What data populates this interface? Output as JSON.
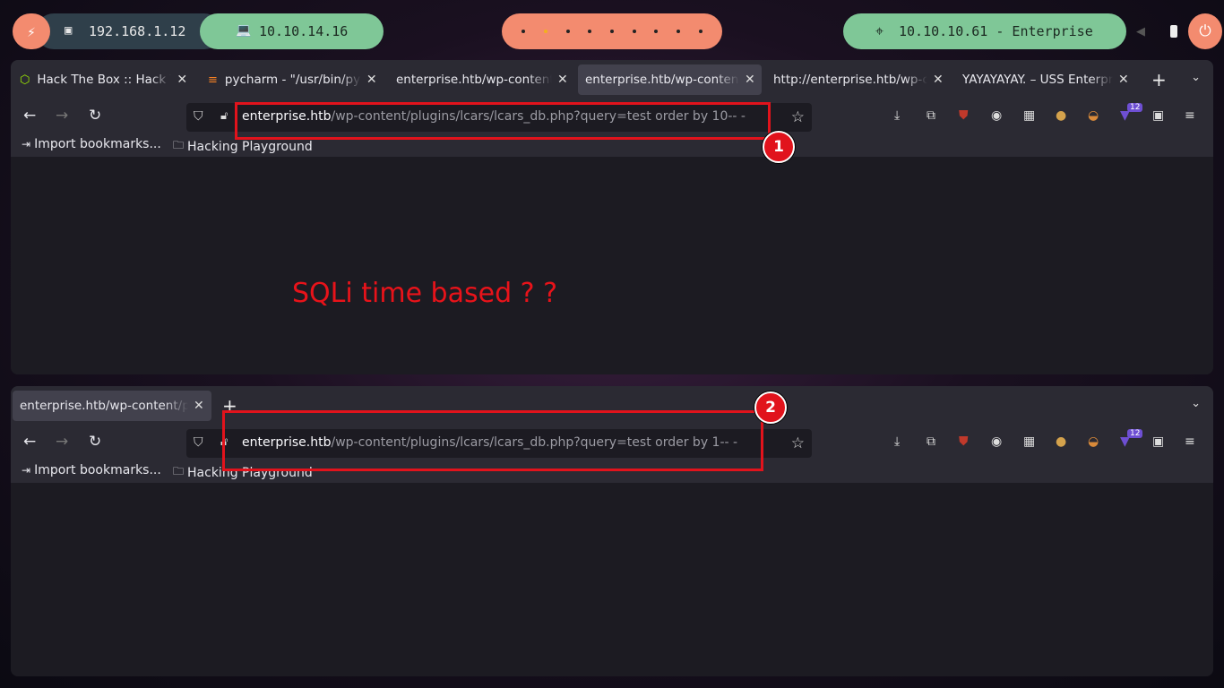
{
  "topbar": {
    "ip_local": "192.168.1.12",
    "ip_vpn": "10.10.14.16",
    "target": "10.10.10.61 - Enterprise",
    "workspaces": 9,
    "active_workspace": 2
  },
  "window1": {
    "tabs": [
      {
        "label": "Hack The Box :: Hack The Box",
        "icon": "htb-icon"
      },
      {
        "label": "pycharm - \"/usr/bin/pycharm\"",
        "icon": "stackoverflow-icon"
      },
      {
        "label": "enterprise.htb/wp-content/plugins",
        "icon": ""
      },
      {
        "label": "enterprise.htb/wp-content/plugins",
        "icon": "",
        "selected": true
      },
      {
        "label": "http://enterprise.htb/wp-content",
        "icon": ""
      },
      {
        "label": "YAYAYAYAY. – USS Enterprise",
        "icon": ""
      }
    ],
    "url_host": "enterprise.htb",
    "url_path": "/wp-content/plugins/lcars/lcars_db.php?query=test order by 10-- -",
    "annotation_number": "1",
    "note": "SQLi time based ? ?"
  },
  "window2": {
    "tabs": [
      {
        "label": "enterprise.htb/wp-content/plugins",
        "selected": true
      }
    ],
    "url_host": "enterprise.htb",
    "url_path": "/wp-content/plugins/lcars/lcars_db.php?query=test order by 1-- -",
    "annotation_number": "2"
  },
  "bookmarks": {
    "import": "Import bookmarks...",
    "folder": "Hacking Playground"
  },
  "extensions": {
    "badge_count": "12"
  },
  "colors": {
    "accent_orange": "#f38b6f",
    "accent_green": "#7fc797",
    "annotation_red": "#e1131c"
  }
}
